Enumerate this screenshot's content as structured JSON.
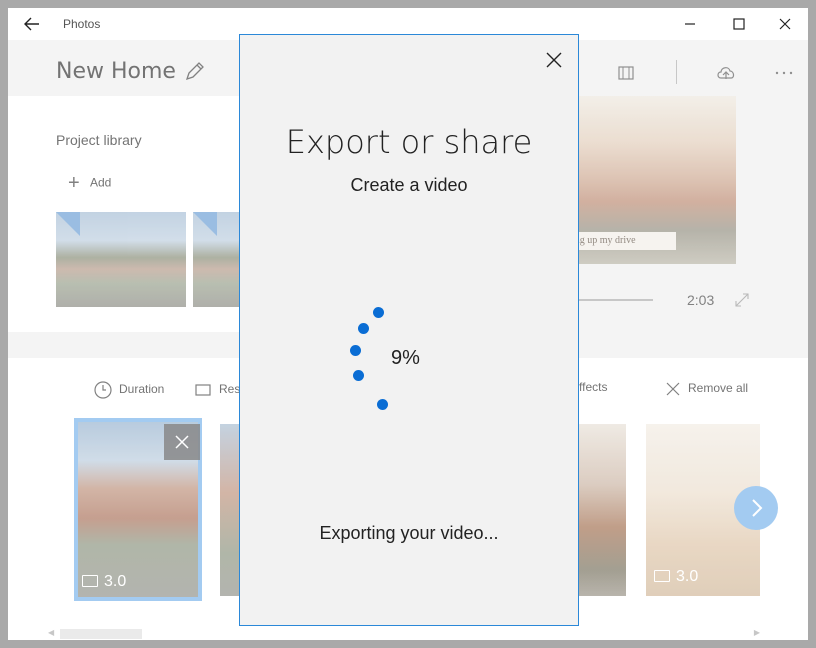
{
  "titlebar": {
    "app_title": "Photos",
    "icons": [
      "back-arrow-icon",
      "minimize-icon",
      "maximize-icon",
      "close-icon"
    ]
  },
  "header": {
    "project_title": "New Home",
    "icons": [
      "pencil-icon",
      "storyboard-icon",
      "upload-icon",
      "more-icon"
    ]
  },
  "library": {
    "title": "Project library",
    "add_label": "Add"
  },
  "preview": {
    "caption": "ing up my drive",
    "time": "2:03"
  },
  "toolbar": {
    "duration_label": "Duration",
    "resize_label": "Res",
    "effects_label": "ffects",
    "remove_all_label": "Remove all"
  },
  "storyboard": {
    "cards": [
      {
        "label": "3.0",
        "selected": true
      },
      {
        "label": "",
        "selected": false
      },
      {
        "label": "",
        "selected": false
      },
      {
        "label": "3.0",
        "selected": false
      }
    ]
  },
  "dialog": {
    "title": "Export or share",
    "subtitle": "Create a video",
    "progress_text": "9%",
    "progress": 0.09,
    "status": "Exporting your video..."
  },
  "colors": {
    "accent": "#0a6dd4",
    "dialog_border": "#2b88d8",
    "dialog_bg": "#f2f2f2",
    "selection": "#8fc0ee"
  }
}
